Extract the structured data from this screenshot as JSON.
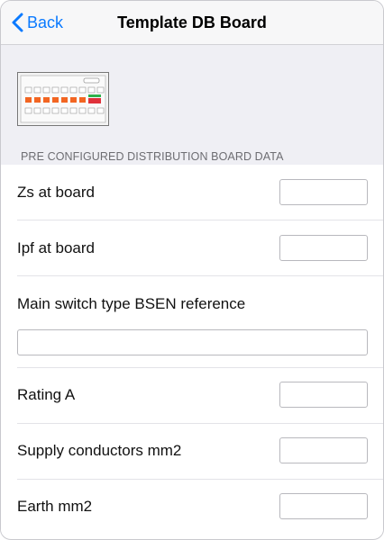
{
  "nav": {
    "back_label": "Back",
    "title": "Template DB Board"
  },
  "section": {
    "label": "PRE CONFIGURED DISTRIBUTION BOARD DATA"
  },
  "fields": [
    {
      "label": "Zs at board",
      "value": ""
    },
    {
      "label": "Ipf at board",
      "value": ""
    },
    {
      "label": "Main switch type BSEN reference",
      "value": ""
    },
    {
      "label": "Rating A",
      "value": ""
    },
    {
      "label": "Supply conductors mm2",
      "value": ""
    },
    {
      "label": "Earth mm2",
      "value": ""
    }
  ],
  "colors": {
    "accent": "#0a7aff",
    "breaker_orange": "#f26522",
    "breaker_red": "#e0313b",
    "breaker_green": "#2fb24c"
  }
}
